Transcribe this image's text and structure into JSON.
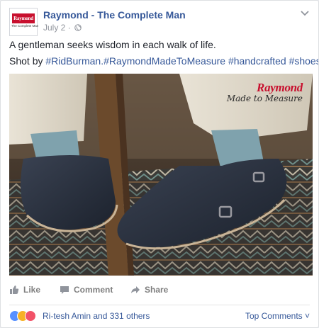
{
  "post": {
    "page_name": "Raymond - The Complete Man",
    "date": "July 2",
    "separator": " · ",
    "avatar_logo": "Raymond",
    "avatar_tagline": "The Complete Man",
    "text_line1": "A gentleman seeks wisdom in each walk of life.",
    "shot_by": "Shot by ",
    "hashtags": "#RidBurman.#RaymondMadeToMeasure #handcrafted #shoes",
    "photo_brand": "Raymond",
    "photo_brand_sub": "Made to Measure"
  },
  "actions": {
    "like": "Like",
    "comment": "Comment",
    "share": "Share"
  },
  "reactions": {
    "summary": "Ri-tesh Amin and 331 others",
    "top_comments": "Top Comments ˅"
  },
  "colors": {
    "link_blue": "#365899",
    "brand_red": "#c8102e",
    "action_gray": "#7f7f7f"
  }
}
